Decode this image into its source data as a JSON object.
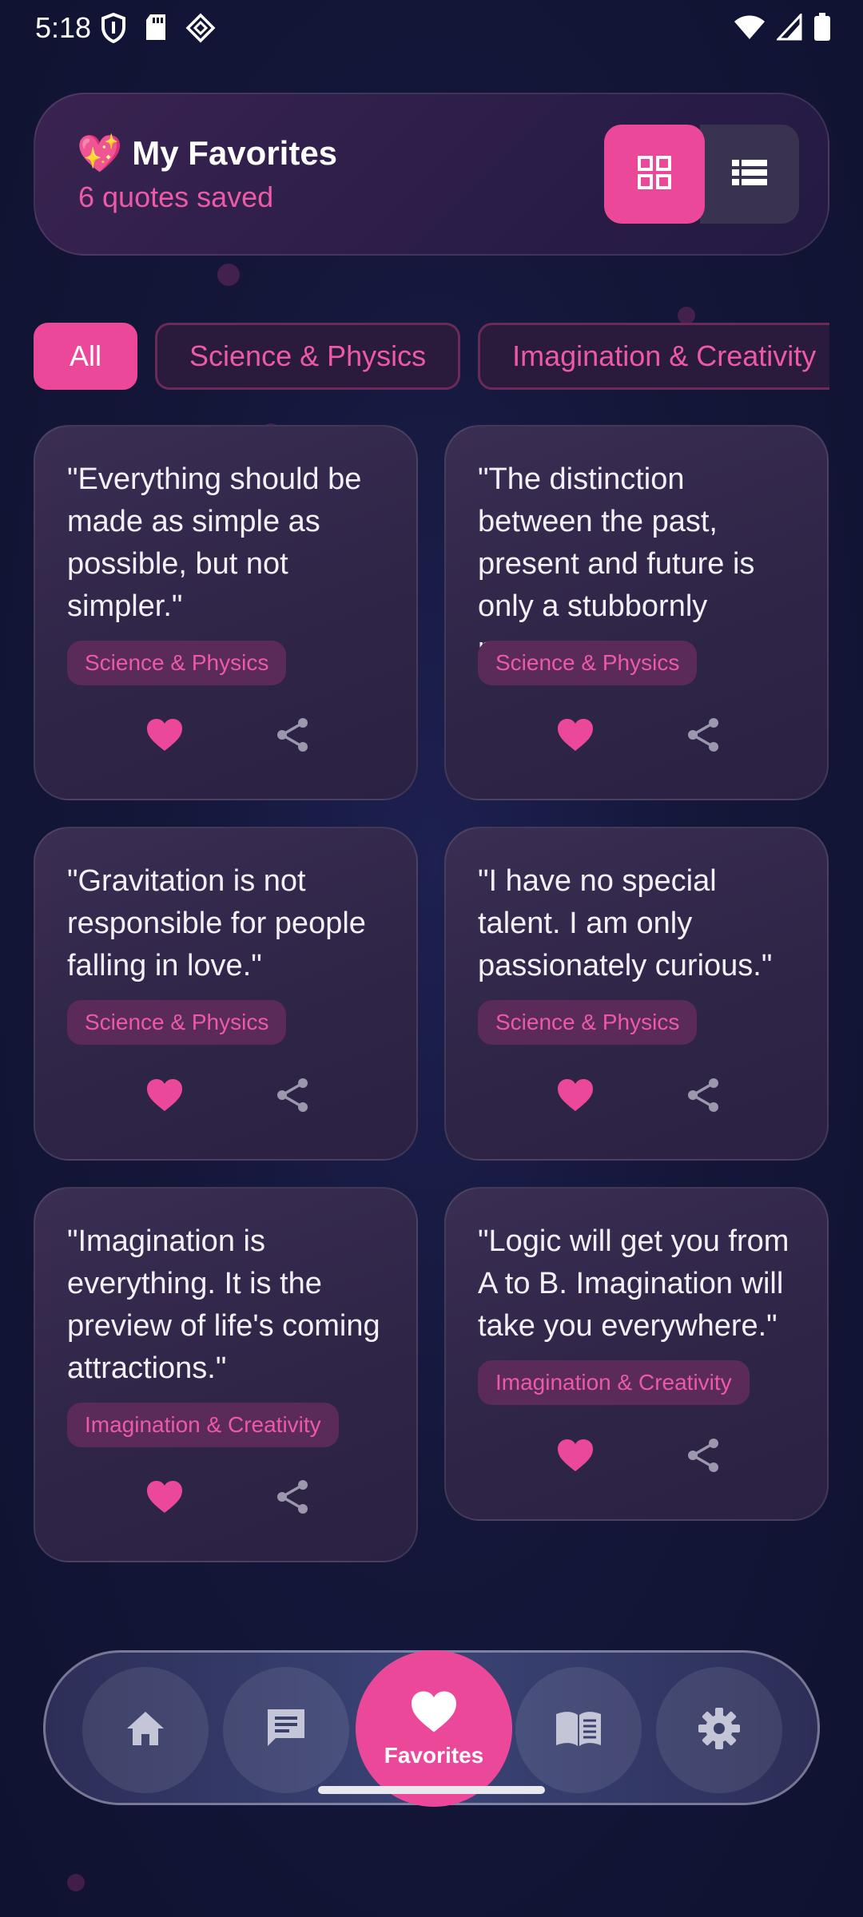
{
  "status_bar": {
    "time": "5:18",
    "icons_left": [
      "shield-icon",
      "sd-card-icon",
      "diamond-icon"
    ],
    "icons_right": [
      "wifi-icon",
      "cell-signal-icon",
      "battery-icon"
    ]
  },
  "header": {
    "emoji": "💖",
    "title": "My Favorites",
    "count_text": "6 quotes saved",
    "view_toggle": {
      "selected": "grid",
      "options": [
        "grid-view-icon",
        "list-view-icon"
      ]
    }
  },
  "filters": {
    "chips": [
      {
        "label": "All",
        "active": true
      },
      {
        "label": "Science & Physics",
        "active": false
      },
      {
        "label": "Imagination & Creativity",
        "active": false
      }
    ]
  },
  "quotes": [
    {
      "text": "\"Everything should be made as simple as possible, but not simpler.\"",
      "category": "Science & Physics"
    },
    {
      "text": "\"The distinction between the past, present and future is only a stubbornly pers…",
      "category": "Science & Physics"
    },
    {
      "text": "\"Gravitation is not responsible for people falling in love.\"",
      "category": "Science & Physics"
    },
    {
      "text": "\"I have no special talent. I am only passionately curious.\"",
      "category": "Science & Physics"
    },
    {
      "text": "\"Imagination is everything. It is the preview of life's coming attractions.\"",
      "category": "Imagination & Creativity"
    },
    {
      "text": "\"Logic will get you from A to B. Imagination will take you everywhere.\"",
      "category": "Imagination & Creativity"
    }
  ],
  "nav": {
    "items": [
      "home-icon",
      "chat-icon",
      "favorites-icon",
      "book-icon",
      "settings-icon"
    ],
    "active_label": "Favorites"
  },
  "colors": {
    "accent": "#ec4899",
    "background": "#111433",
    "card": "#302648"
  }
}
